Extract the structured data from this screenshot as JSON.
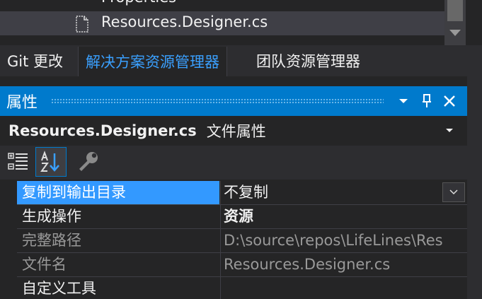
{
  "solution_tree": {
    "items": [
      {
        "label": "Properties"
      },
      {
        "label": "Resources.Designer.cs"
      }
    ]
  },
  "tool_tabs": [
    {
      "label": "Git 更改"
    },
    {
      "label": "解决方案资源管理器",
      "active": true
    },
    {
      "label": "团队资源管理器"
    }
  ],
  "properties_window": {
    "title": "属性",
    "object_name": "Resources.Designer.cs",
    "object_type": "文件属性",
    "rows": [
      {
        "name": "复制到输出目录",
        "value": "不复制",
        "selected": true
      },
      {
        "name": "生成操作",
        "value": "资源"
      },
      {
        "name": "完整路径",
        "value": "D:\\source\\repos\\LifeLines\\Res",
        "readonly": true
      },
      {
        "name": "文件名",
        "value": "Resources.Designer.cs",
        "readonly": true
      },
      {
        "name": "自定义工具",
        "value": ""
      }
    ]
  },
  "colors": {
    "accent": "#007acc",
    "selection": "#3399ff",
    "active_tab_text": "#3aa0ff",
    "background": "#252526"
  },
  "icons": [
    "file-icon",
    "categorized-icon",
    "alphabetical-sort-icon",
    "property-pages-wrench-icon",
    "pin-icon",
    "close-icon",
    "chevron-down-icon"
  ]
}
